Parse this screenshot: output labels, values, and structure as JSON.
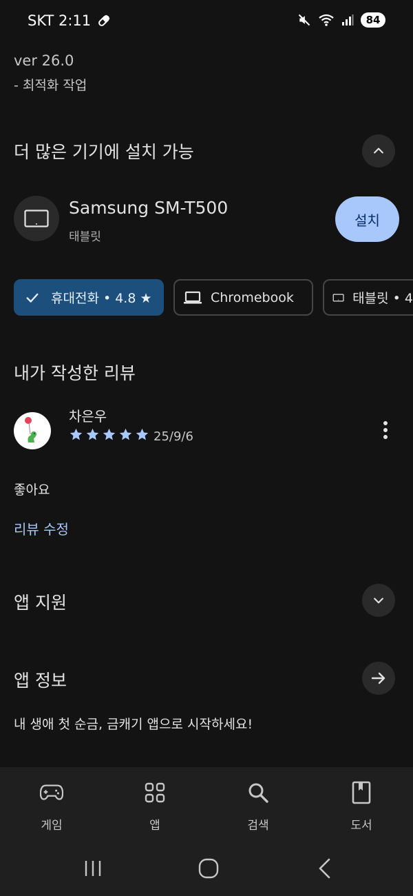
{
  "status": {
    "carrier_time": "SKT 2:11",
    "battery": "84"
  },
  "version": {
    "label": "ver 26.0",
    "note": "- 최적화 작업"
  },
  "devices_section": {
    "title": "더 많은 기기에 설치 가능",
    "device_name": "Samsung SM-T500",
    "device_type": "태블릿",
    "install_label": "설치"
  },
  "chips": [
    {
      "label": "휴대전화 • 4.8 ★",
      "selected": true
    },
    {
      "label": "Chromebook",
      "selected": false
    },
    {
      "label": "태블릿 • 4",
      "selected": false
    }
  ],
  "review_section": {
    "title": "내가 작성한 리뷰",
    "reviewer": "차은우",
    "rating": 5,
    "date": "25/9/6",
    "text": "좋아요",
    "edit_label": "리뷰 수정"
  },
  "app_support": {
    "title": "앱 지원"
  },
  "app_info": {
    "title": "앱 정보",
    "description": "내 생애 첫 순금, 금캐기 앱으로 시작하세요!"
  },
  "bottom_nav": [
    {
      "label": "게임",
      "icon": "gamepad-icon"
    },
    {
      "label": "앱",
      "icon": "apps-grid-icon"
    },
    {
      "label": "검색",
      "icon": "search-icon"
    },
    {
      "label": "도서",
      "icon": "book-icon"
    }
  ],
  "colors": {
    "accent": "#a8c7fa",
    "chip_selected": "#1d4f7c",
    "background": "#131313"
  }
}
